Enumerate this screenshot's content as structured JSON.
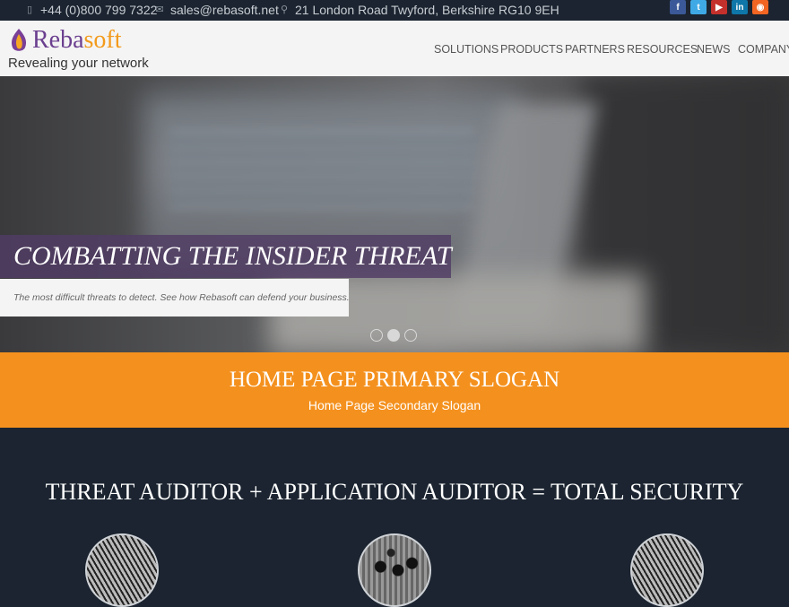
{
  "topbar": {
    "phone": "+44 (0)800 799 7322",
    "email": "sales@rebasoft.net",
    "address": "21 London Road Twyford, Berkshire RG10 9EH",
    "phone_icon": "mobile-phone-icon",
    "email_icon": "envelope-icon",
    "address_icon": "map-pin-icon",
    "social": [
      {
        "icon": "facebook-icon",
        "glyph": "f",
        "color": "#3b5998"
      },
      {
        "icon": "twitter-icon",
        "glyph": "t",
        "color": "#3fa9e6"
      },
      {
        "icon": "youtube-icon",
        "glyph": "▶",
        "color": "#c4302b"
      },
      {
        "icon": "linkedin-icon",
        "glyph": "in",
        "color": "#0e76a8"
      },
      {
        "icon": "rss-icon",
        "glyph": "◉",
        "color": "#f26522"
      }
    ]
  },
  "header": {
    "logo_name_a": "Reba",
    "logo_name_b": "soft",
    "logo_tagline": "Revealing your network",
    "nav": [
      "SOLUTIONS",
      "PRODUCTS",
      "PARTNERS",
      "RESOURCES",
      "NEWS",
      "COMPANY"
    ]
  },
  "hero": {
    "title": "COMBATTING THE INSIDER THREAT",
    "subtitle": "The most difficult threats to detect. See how Rebasoft can defend your business.",
    "slides": 3,
    "active_slide": 2
  },
  "band": {
    "primary": "HOME PAGE PRIMARY SLOGAN",
    "secondary": "Home Page Secondary Slogan"
  },
  "section": {
    "heading": "THREAT AUDITOR + APPLICATION AUDITOR = TOTAL SECURITY"
  },
  "colors": {
    "accent_orange": "#f4911e",
    "brand_purple": "#6b3f8f",
    "dark_navy": "#1b2430"
  }
}
